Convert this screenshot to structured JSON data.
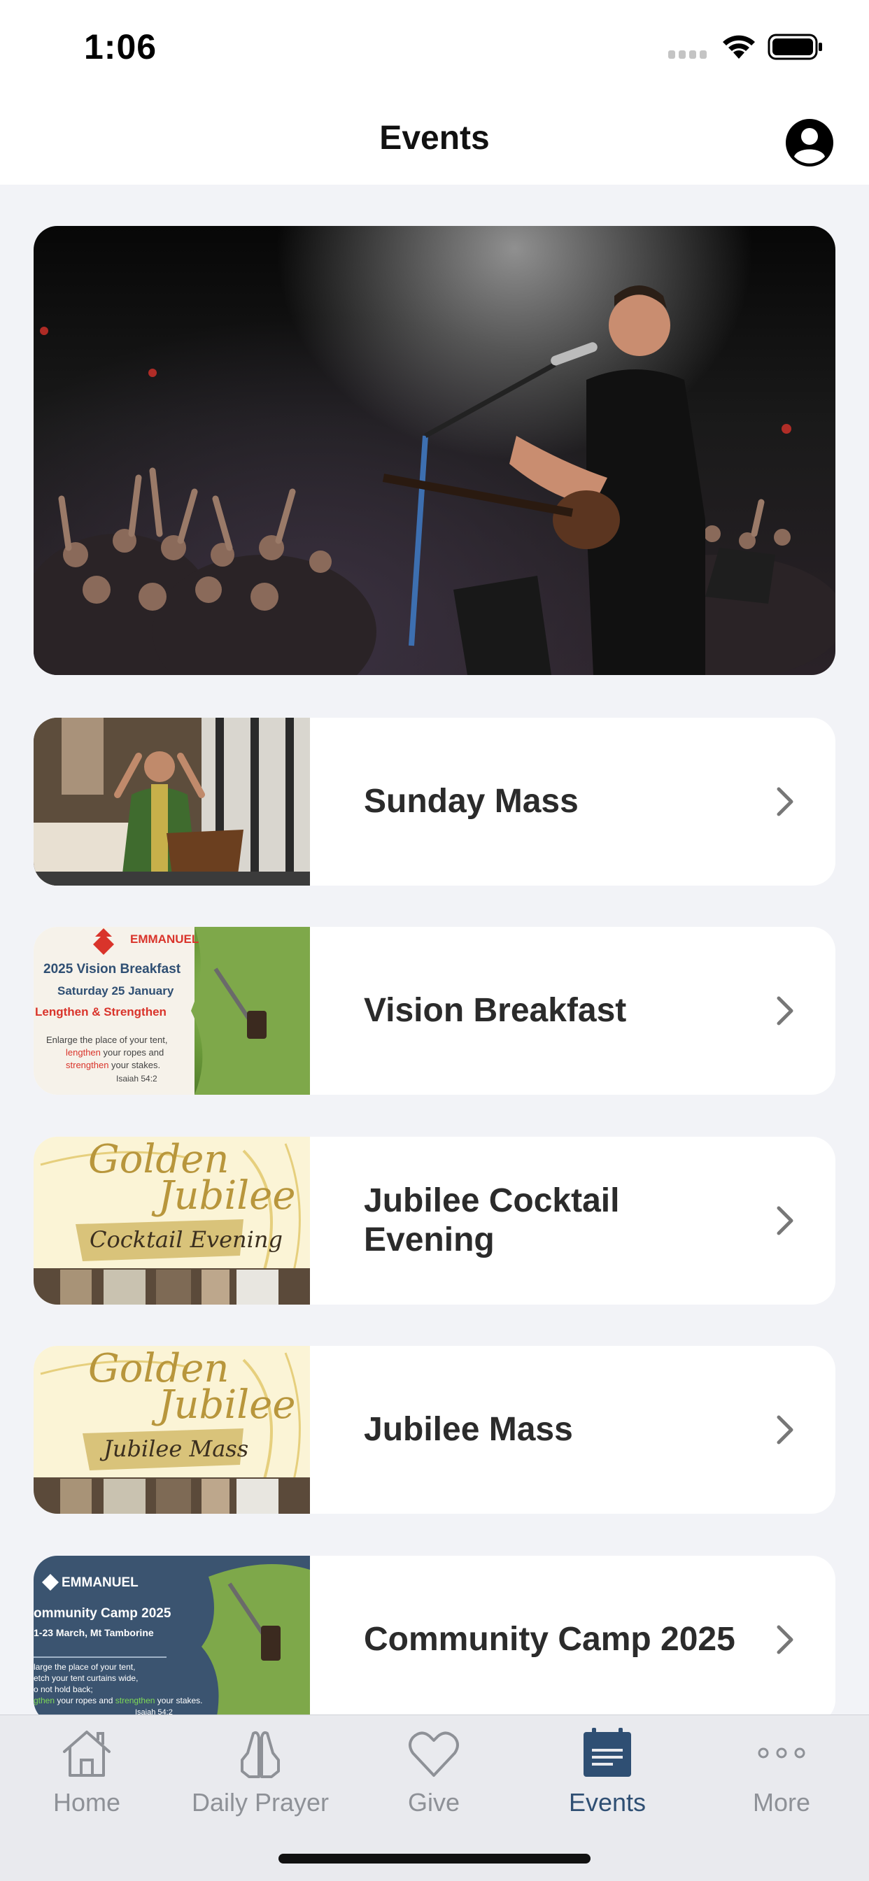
{
  "status_bar": {
    "time": "1:06"
  },
  "header": {
    "title": "Events"
  },
  "events": [
    {
      "title": "Sunday Mass",
      "thumb": {
        "kind": "photo"
      }
    },
    {
      "title": "Vision Breakfast",
      "thumb": {
        "brand": "EMMANUEL",
        "heading": "2025 Vision Breakfast",
        "date": "Saturday 25 January",
        "tagline": "Lengthen & Strengthen",
        "verse_line1": "Enlarge the place of your tent,",
        "verse_line2_highlight": "lengthen",
        "verse_line2_rest": " your ropes and",
        "verse_line3_highlight": "strengthen",
        "verse_line3_rest": " your stakes.",
        "ref": "Isaiah 54:2"
      }
    },
    {
      "title": "Jubilee Cocktail Evening",
      "thumb": {
        "line1": "Golden",
        "line2": "Jubilee",
        "banner": "Cocktail Evening"
      }
    },
    {
      "title": "Jubilee Mass",
      "thumb": {
        "line1": "Golden",
        "line2": "Jubilee",
        "banner": "Jubilee Mass"
      }
    },
    {
      "title": "Community Camp 2025",
      "thumb": {
        "brand": "EMMANUEL",
        "heading": "ommunity Camp 2025",
        "date": "1-23 March, Mt Tamborine",
        "verse_line1": "large the place of your tent,",
        "verse_line2": "etch your tent curtains wide,",
        "verse_line3": "o not hold back;",
        "verse_line4_highlight": "gthen",
        "verse_line4_rest": " your ropes and ",
        "verse_line4_highlight2": "strengthen",
        "verse_line4_rest2": " your stakes.",
        "ref": "Isaiah 54:2"
      }
    }
  ],
  "tab_bar": {
    "tabs": [
      {
        "label": "Home",
        "icon": "home-icon"
      },
      {
        "label": "Daily Prayer",
        "icon": "praying-hands-icon"
      },
      {
        "label": "Give",
        "icon": "heart-icon"
      },
      {
        "label": "Events",
        "icon": "calendar-icon",
        "active": true
      },
      {
        "label": "More",
        "icon": "more-icon"
      }
    ]
  },
  "colors": {
    "accent": "#2f4f73",
    "inactive": "#8e9197",
    "background": "#f2f3f7"
  }
}
